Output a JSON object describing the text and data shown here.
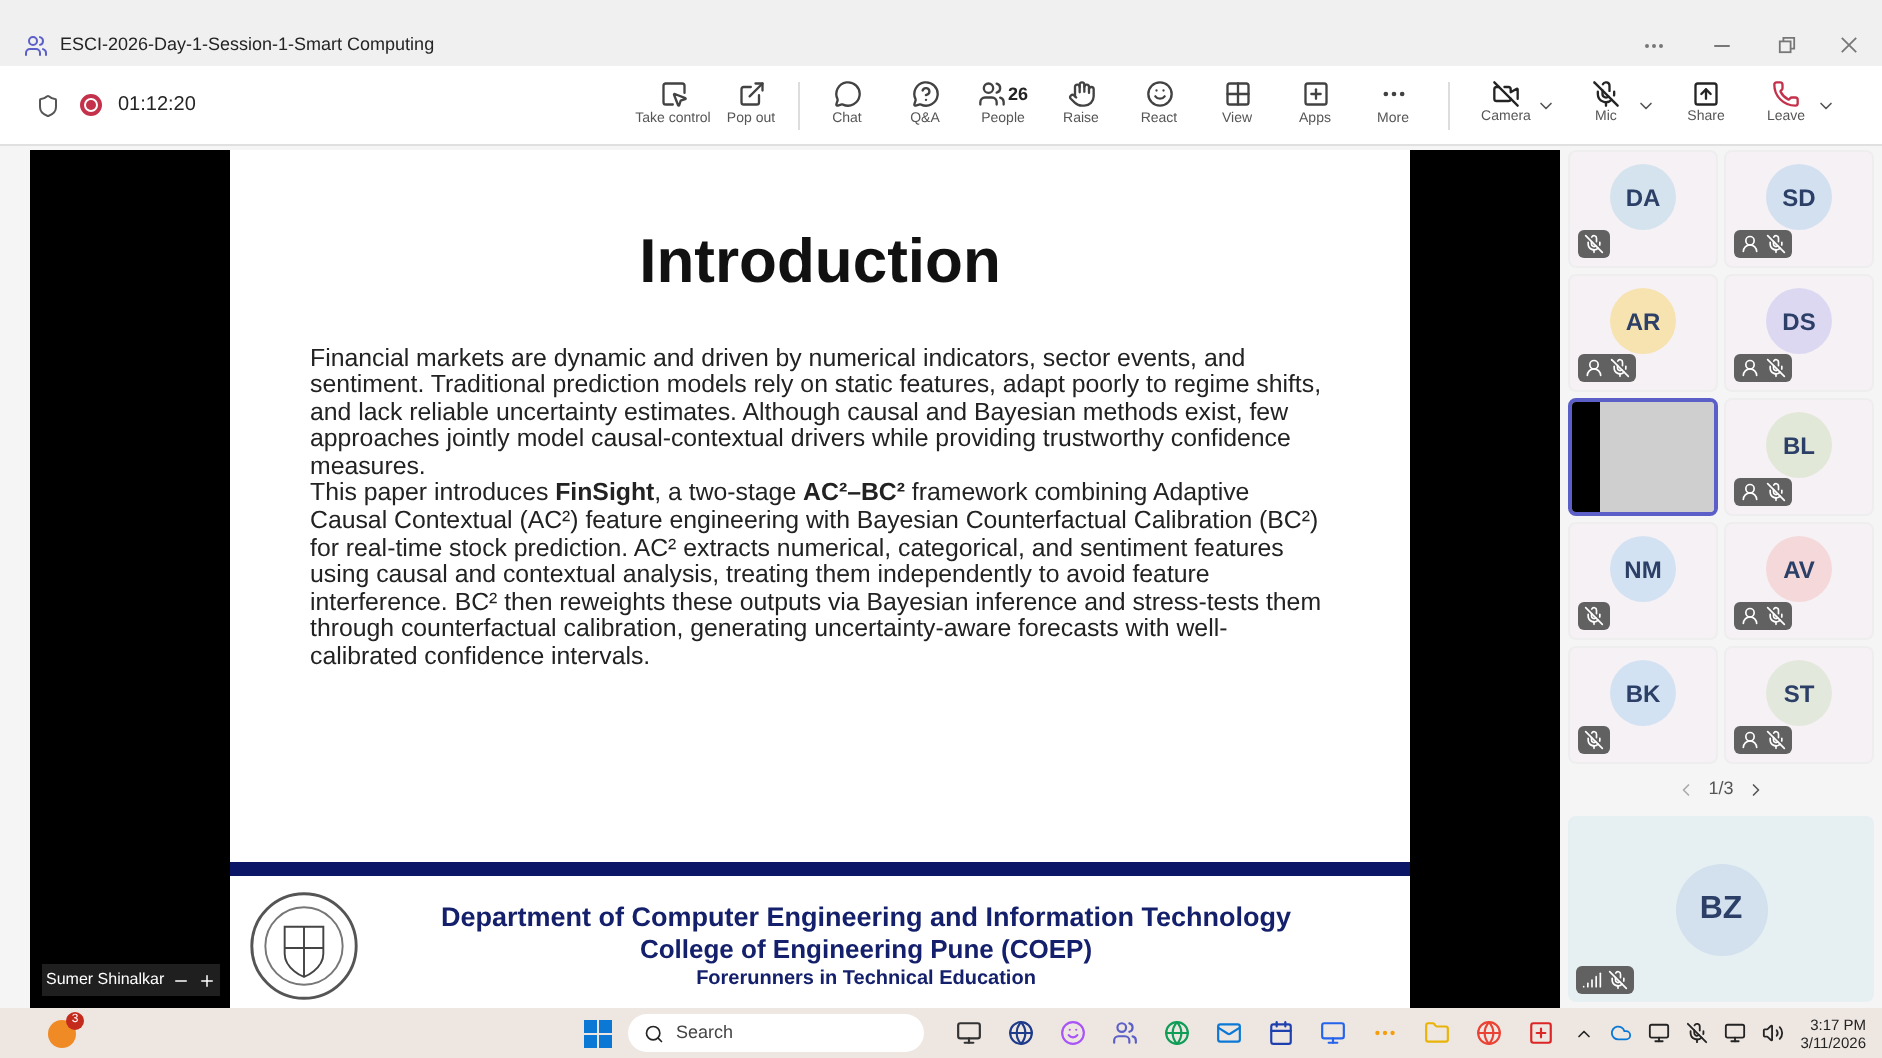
{
  "window": {
    "title": "ESCI-2026-Day-1-Session-1-Smart Computing"
  },
  "meeting": {
    "timer": "01:12:20",
    "recording": true
  },
  "toolbar": [
    {
      "label": "Take control"
    },
    {
      "label": "Pop out"
    },
    {
      "label": "Chat"
    },
    {
      "label": "Q&A"
    },
    {
      "label": "People",
      "count": "26"
    },
    {
      "label": "Raise"
    },
    {
      "label": "React"
    },
    {
      "label": "View"
    },
    {
      "label": "Apps"
    },
    {
      "label": "More"
    }
  ],
  "controls": [
    {
      "label": "Camera",
      "dropdown": true,
      "kind": "camera"
    },
    {
      "label": "Mic",
      "dropdown": true,
      "kind": "mic"
    },
    {
      "label": "Share",
      "dropdown": false,
      "kind": "share"
    },
    {
      "label": "Leave",
      "dropdown": true,
      "kind": "leave"
    }
  ],
  "slide": {
    "title": "Introduction",
    "paragraphs": [
      "Financial markets are dynamic and driven by numerical indicators, sector events, and sentiment. Traditional prediction models rely on static features, adapt poorly to regime shifts, and lack reliable uncertainty estimates. Although causal and Bayesian methods exist, few approaches jointly model causal-contextual drivers while providing trustworthy confidence measures.",
      "This paper introduces **FinSight**, a two-stage **AC²–BC²** framework combining Adaptive Causal Contextual (AC²) feature engineering with Bayesian Counterfactual Calibration (BC²) for real-time stock prediction. AC² extracts numerical, categorical, and sentiment features using causal and contextual analysis, treating them independently to avoid feature interference. BC² then reweights these outputs via Bayesian inference and stress-tests them through counterfactual calibration, generating uncertainty-aware forecasts with well-calibrated confidence intervals."
    ],
    "footer": {
      "department": "Department of Computer Engineering and Information Technology",
      "college": "College of Engineering Pune (COEP)",
      "motto": "Forerunners in Technical Education"
    }
  },
  "presenter": {
    "name": "Sumer Shinalkar"
  },
  "participants": [
    {
      "kind": "avatar",
      "initials": "DA",
      "color": "#d5e3ee",
      "badge": false,
      "selected": false
    },
    {
      "kind": "avatar",
      "initials": "SD",
      "color": "#d3e0f0",
      "badge": true,
      "selected": false
    },
    {
      "kind": "avatar",
      "initials": "AR",
      "color": "#f7e3b0",
      "badge": true,
      "selected": false
    },
    {
      "kind": "avatar",
      "initials": "DS",
      "color": "#ddd8f2",
      "badge": true,
      "selected": false
    },
    {
      "kind": "video",
      "selected": true
    },
    {
      "kind": "avatar",
      "initials": "BL",
      "color": "#e2e8d8",
      "badge": true,
      "selected": false
    },
    {
      "kind": "avatar",
      "initials": "NM",
      "color": "#d3e2f2",
      "badge": false,
      "selected": false
    },
    {
      "kind": "avatar",
      "initials": "AV",
      "color": "#f5d8da",
      "badge": true,
      "selected": false
    },
    {
      "kind": "avatar",
      "initials": "BK",
      "color": "#d3e2f2",
      "badge": false,
      "selected": false
    },
    {
      "kind": "avatar",
      "initials": "ST",
      "color": "#e3e8dc",
      "badge": true,
      "selected": false
    }
  ],
  "pager": "1/3",
  "spotlight": {
    "initials": "BZ",
    "color": "#d3e0ee"
  },
  "taskbar": {
    "notification_count": "3",
    "search_placeholder": "Search",
    "time": "3:17 PM",
    "date": "3/11/2026"
  }
}
